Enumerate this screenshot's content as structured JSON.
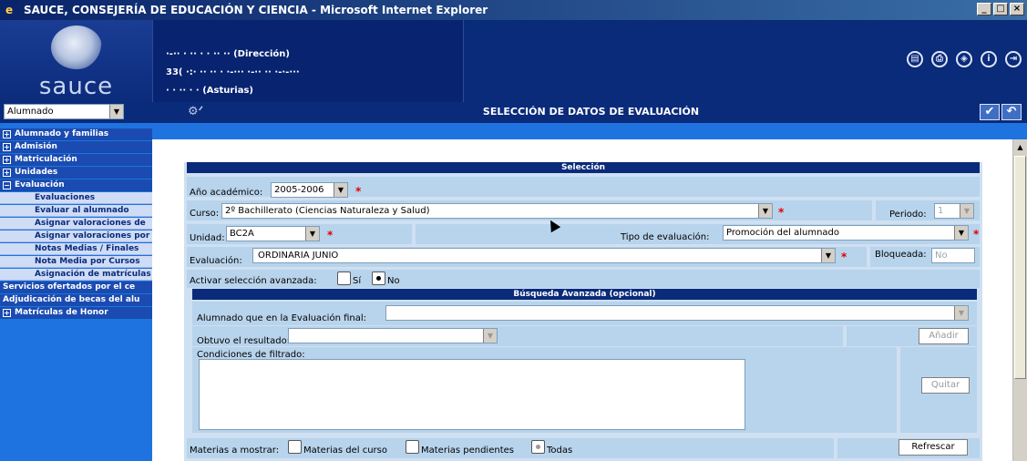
{
  "window": {
    "title": "SAUCE, CONSEJERÍA DE EDUCACIÓN Y CIENCIA - Microsoft Internet Explorer"
  },
  "logo": {
    "text": "sauce"
  },
  "address": {
    "line1": "·-·· · ·· · · ·· ·· (Dirección)",
    "line2": "33( ·:· ·· ·· · ·-··· ·-·· ·· ·-·-···",
    "line3": "· · ·· · · (Asturias)"
  },
  "header_icons": [
    "doc-icon",
    "print-icon",
    "nav-icon",
    "info-icon",
    "exit-icon"
  ],
  "module_select": {
    "value": "Alumnado"
  },
  "page_title": "SELECCIÓN DE DATOS DE EVALUACIÓN",
  "sidebar": {
    "items": [
      {
        "label": "Alumnado y familias",
        "kind": "top"
      },
      {
        "label": "Admisión",
        "kind": "top"
      },
      {
        "label": "Matriculación",
        "kind": "top"
      },
      {
        "label": "Unidades",
        "kind": "top"
      },
      {
        "label": "Evaluación",
        "kind": "top-open"
      },
      {
        "label": "Evaluaciones",
        "kind": "sub"
      },
      {
        "label": "Evaluar al alumnado",
        "kind": "sub"
      },
      {
        "label": "Asignar valoraciones de",
        "kind": "sub"
      },
      {
        "label": "Asignar valoraciones por",
        "kind": "sub"
      },
      {
        "label": "Notas Medias / Finales",
        "kind": "sub"
      },
      {
        "label": "Nota Media por Cursos",
        "kind": "sub"
      },
      {
        "label": "Asignación de matrículas",
        "kind": "sub"
      },
      {
        "label": "Servicios ofertados por el ce",
        "kind": "noplus"
      },
      {
        "label": "Adjudicación de becas del alu",
        "kind": "noplus"
      },
      {
        "label": "Matrículas de Honor",
        "kind": "top"
      }
    ]
  },
  "seleccion": {
    "header": "Selección",
    "anio_label": "Año académico:",
    "anio_value": "2005-2006",
    "curso_label": "Curso:",
    "curso_value": "2º Bachillerato (Ciencias Naturaleza y Salud)",
    "periodo_label": "Periodo:",
    "periodo_value": "1",
    "unidad_label": "Unidad:",
    "unidad_value": "BC2A",
    "tipo_label": "Tipo de evaluación:",
    "tipo_value": "Promoción del alumnado",
    "evaluacion_label": "Evaluación:",
    "evaluacion_value": "ORDINARIA JUNIO",
    "bloqueada_label": "Bloqueada:",
    "bloqueada_value": "No",
    "activar_label": "Activar selección avanzada:",
    "si_label": "Sí",
    "no_label": "No",
    "required_mark": "*"
  },
  "busqueda": {
    "header": "Búsqueda Avanzada (opcional)",
    "alumnado_label": "Alumnado que en la Evaluación final:",
    "obtuvo_label": "Obtuvo el resultado:",
    "anadir_label": "Añadir",
    "condiciones_label": "Condiciones de filtrado:",
    "quitar_label": "Quitar"
  },
  "materias": {
    "label": "Materias a mostrar:",
    "opt1": "Materias del curso",
    "opt2": "Materias pendientes",
    "opt3": "Todas",
    "refrescar_label": "Refrescar"
  }
}
